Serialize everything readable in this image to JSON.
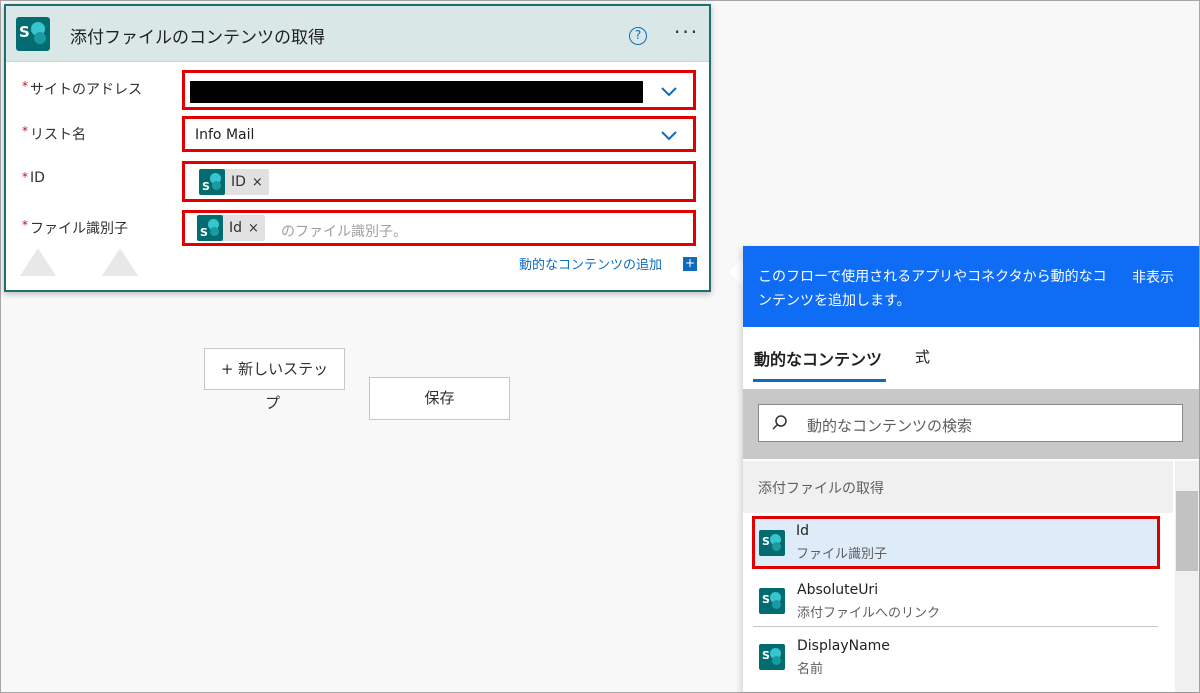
{
  "card": {
    "title": "添付ファイルのコンテンツの取得",
    "help_symbol": "?",
    "more_symbol": "···",
    "fields": [
      {
        "label": "サイトのアドレス",
        "value": ""
      },
      {
        "label": "リスト名",
        "value": "Info Mail"
      },
      {
        "label": "ID",
        "token": "ID"
      },
      {
        "label": "ファイル識別子",
        "token": "Id",
        "placeholder_tail": "のファイル識別子。"
      }
    ],
    "required_mark": "*",
    "remove_symbol": "×",
    "dynamic_link": "動的なコンテンツの追加",
    "plus_symbol": "+"
  },
  "canvas": {
    "new_step_label": "+ 新しいステッ",
    "new_step_overflow": "プ",
    "save_label": "保存"
  },
  "panel": {
    "description": "このフローで使用されるアプリやコネクタから動的なコンテンツを追加します。",
    "hide_label": "非表示",
    "tabs": [
      "動的なコンテンツ",
      "式"
    ],
    "search_placeholder": "動的なコンテンツの検索",
    "group_label": "添付ファイルの取得",
    "items": [
      {
        "name": "Id",
        "desc": "ファイル識別子"
      },
      {
        "name": "AbsoluteUri",
        "desc": "添付ファイルへのリンク"
      },
      {
        "name": "DisplayName",
        "desc": "名前"
      }
    ]
  },
  "colors": {
    "accent_blue": "#0f6cbd",
    "panel_header": "#0f6cf5",
    "highlight_red": "#e00000",
    "sharepoint_teal": "#036c70"
  },
  "icons": {
    "logo": "S"
  }
}
